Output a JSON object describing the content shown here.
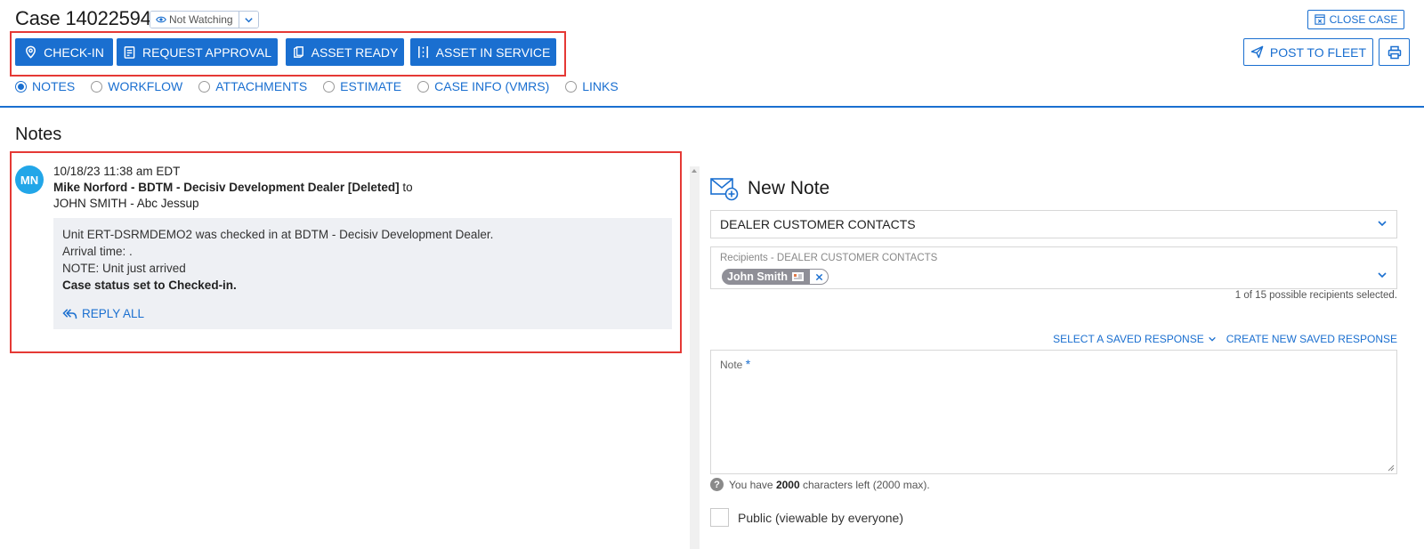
{
  "header": {
    "title": "Case 14022594",
    "watch_label": "Not Watching",
    "close_case_label": "CLOSE CASE"
  },
  "actions": {
    "check_in": "CHECK-IN",
    "request_approval": "REQUEST APPROVAL",
    "asset_ready": "ASSET READY",
    "asset_in_service": "ASSET IN SERVICE",
    "post_to_fleet": "POST TO FLEET"
  },
  "tabs": [
    {
      "label": "NOTES",
      "selected": true
    },
    {
      "label": "WORKFLOW",
      "selected": false
    },
    {
      "label": "ATTACHMENTS",
      "selected": false
    },
    {
      "label": "ESTIMATE",
      "selected": false
    },
    {
      "label": "CASE INFO (VMRS)",
      "selected": false
    },
    {
      "label": "LINKS",
      "selected": false
    }
  ],
  "notes": {
    "heading": "Notes",
    "items": [
      {
        "avatar_initials": "MN",
        "timestamp": "10/18/23 11:38 am EDT",
        "author": "Mike Norford - BDTM - Decisiv Development Dealer [Deleted]",
        "to_word": "to",
        "recipient": "JOHN SMITH - Abc Jessup",
        "body_lines": [
          "Unit ERT-DSRMDEMO2 was checked in at BDTM - Decisiv Development Dealer.",
          "Arrival time: .",
          "NOTE: Unit just arrived"
        ],
        "status_line": "Case status set to Checked-in.",
        "reply_all_label": "REPLY ALL"
      }
    ]
  },
  "new_note": {
    "title": "New Note",
    "contact_type": "DEALER CUSTOMER CONTACTS",
    "recipients_label": "Recipients - DEALER CUSTOMER CONTACTS",
    "recipient_chip": "John Smith",
    "recipients_count": "1 of 15 possible recipients selected.",
    "select_saved_response": "SELECT A SAVED RESPONSE",
    "create_saved_response": "CREATE NEW SAVED RESPONSE",
    "note_label": "Note",
    "required_mark": "*",
    "chars_prefix": "You have",
    "chars_left": "2000",
    "chars_suffix": "characters left (2000 max).",
    "public_label": "Public (viewable by everyone)"
  },
  "colors": {
    "accent": "#1a6fd0",
    "highlight_border": "#e53935",
    "avatar": "#22a6e8"
  }
}
